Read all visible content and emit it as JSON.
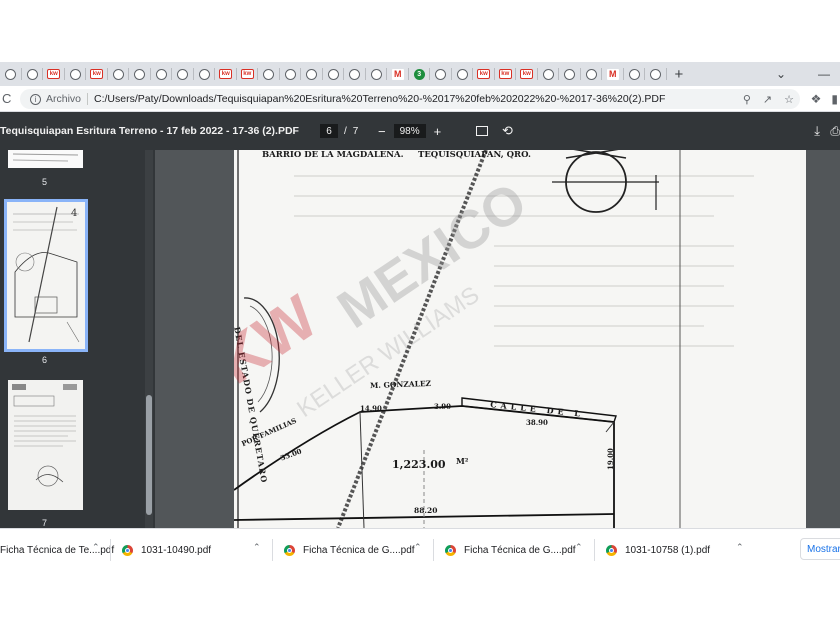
{
  "browser": {
    "tab_favicons": [
      "globe",
      "globe",
      "kw",
      "globe",
      "kw",
      "globe",
      "globe",
      "globe",
      "globe",
      "globe",
      "kw",
      "kw",
      "globe",
      "globe",
      "globe",
      "globe",
      "globe",
      "globe",
      "gmail",
      "green",
      "globe",
      "globe",
      "kw",
      "kw",
      "kw",
      "globe",
      "globe",
      "globe",
      "gmail",
      "globe",
      "globe"
    ],
    "green_badge": "3",
    "kw_label": "kw",
    "gmail_label": "M",
    "new_tab_label": "+",
    "window_controls": {
      "chevron": "⌄",
      "minimize": "—"
    },
    "reload_glyph": "C",
    "info_glyph": "i",
    "address_prefix": "Archivo",
    "url": "C:/Users/Paty/Downloads/Tequisquiapan%20Esritura%20Terreno%20-%2017%20feb%202022%20-%2017-36%20(2).PDF"
  },
  "pdf_toolbar": {
    "title": "Tequisquiapan Esritura Terreno - 17 feb 2022 - 17-36 (2).PDF",
    "current_page": "6",
    "page_separator": "/",
    "total_pages": "7",
    "zoom_out": "−",
    "zoom": "98%",
    "zoom_in": "+"
  },
  "thumbnails": [
    {
      "label": "5"
    },
    {
      "label": "6",
      "selected": true,
      "marker": "4"
    },
    {
      "label": "7"
    }
  ],
  "page": {
    "header_left": "BARRIO DE LA MAGDALENA.",
    "header_right": "TEQUISQUIAPAN, QRO.",
    "neighbor_north": "M. GONZALEZ",
    "neighbor_east": "CALLE DE L",
    "neighbor_west": "POR FAMILIAS",
    "area": "1,223.00",
    "area_unit": "M²",
    "dim_14_90": "14.90",
    "dim_3_90": "3.90",
    "dim_38_90": "38.90",
    "dim_33_00": "33.00",
    "dim_88_20": "88.20",
    "dim_19_00": "19.00",
    "seal_text": "DEL ESTADO DE QUERETARO",
    "watermark_brand": "MEXICO",
    "watermark_sub": "KELLER WILLIAMS"
  },
  "downloads": {
    "items": [
      {
        "name": "Ficha Técnica de Te....pdf"
      },
      {
        "name": "1031-10490.pdf"
      },
      {
        "name": "Ficha Técnica de G....pdf"
      },
      {
        "name": "Ficha Técnica de G....pdf"
      },
      {
        "name": "1031-10758 (1).pdf"
      }
    ],
    "show_all": "Mostrar todo"
  },
  "colors": {
    "tab_strip": "#dee1e6",
    "pdf_toolbar": "#323639",
    "viewer_bg": "#525659",
    "thumb_selected": "#8ab4f8",
    "watermark_red": "#c41e2a",
    "link_blue": "#1a73e8"
  }
}
